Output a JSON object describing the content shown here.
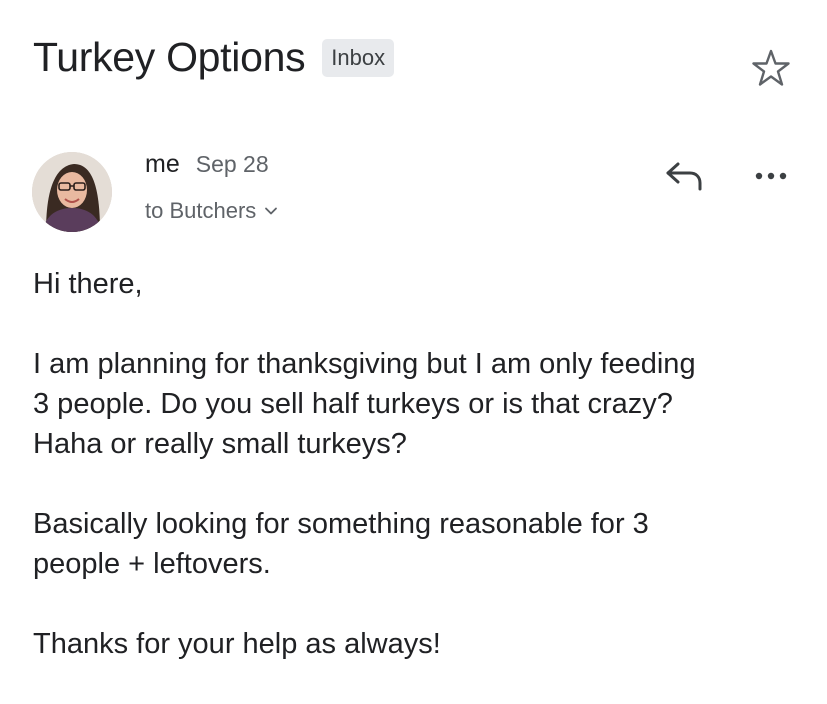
{
  "email": {
    "subject": "Turkey Options",
    "label": "Inbox",
    "sender": "me",
    "date": "Sep 28",
    "recipient": "to Butchers",
    "body": {
      "greeting": "Hi there,",
      "paragraph1_line1": "I am planning for thanksgiving but I am only feeding",
      "paragraph1_line2": "3 people. Do you sell half turkeys or is that crazy?",
      "paragraph1_line3": "Haha or really small turkeys?",
      "paragraph2_line1": "Basically looking for something reasonable for 3",
      "paragraph2_line2": "people + leftovers.",
      "closing": "Thanks for your help as always!"
    }
  },
  "icons": {
    "star": "star-icon",
    "reply": "reply-icon",
    "more": "more-icon",
    "chevron": "chevron-down-icon"
  },
  "colors": {
    "text_primary": "#202124",
    "text_secondary": "#5f6368",
    "chip_background": "#e8eaed"
  }
}
